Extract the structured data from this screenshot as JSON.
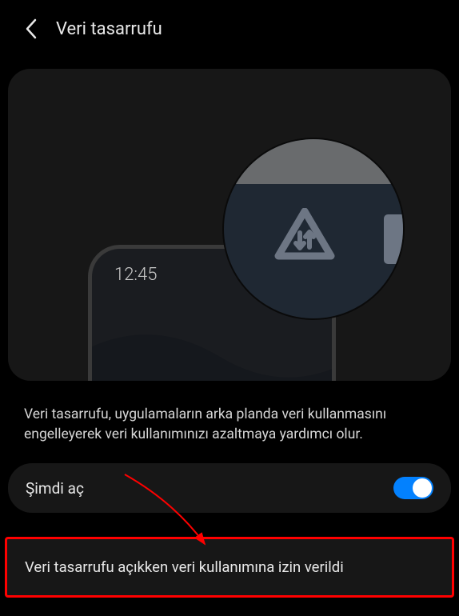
{
  "header": {
    "title": "Veri tasarrufu"
  },
  "illustration": {
    "phone_time": "12:45"
  },
  "description": "Veri tasarrufu, uygulamaların arka planda veri kullanmasını engelleyerek veri kullanımınızı azaltmaya yardımcı olur.",
  "toggle": {
    "label": "Şimdi aç",
    "state": true
  },
  "allow_row": {
    "label": "Veri tasarrufu açıkken veri kullanımına izin verildi"
  },
  "colors": {
    "accent": "#0381fe",
    "highlight_border": "#ff0000"
  }
}
